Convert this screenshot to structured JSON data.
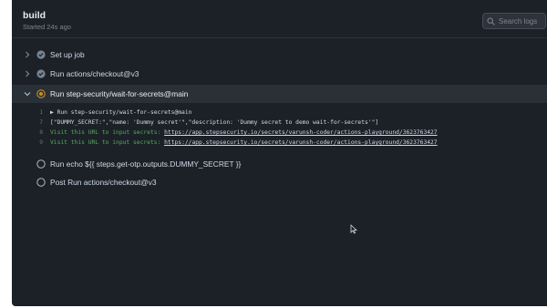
{
  "job": {
    "title": "build",
    "started": "Started 24s ago"
  },
  "search": {
    "placeholder": "Search logs",
    "icon": "search-icon"
  },
  "steps": [
    {
      "label": "Set up job",
      "status": "success",
      "expanded": false
    },
    {
      "label": "Run actions/checkout@v3",
      "status": "success",
      "expanded": false
    },
    {
      "label": "Run step-security/wait-for-secrets@main",
      "status": "in-progress",
      "expanded": true
    },
    {
      "label": "Run echo ${{ steps.get-otp.outputs.DUMMY_SECRET }}",
      "status": "pending",
      "expanded": false
    },
    {
      "label": "Post Run actions/checkout@v3",
      "status": "pending",
      "expanded": false
    }
  ],
  "log": [
    {
      "line": "1",
      "text": "▶ Run step-security/wait-for-secrets@main"
    },
    {
      "line": "7",
      "text": "[\"DUMMY_SECRET:\",\"name: 'Dummy secret'\",\"description: 'Dummy secret to demo wait-for-secrets'\"]"
    },
    {
      "line": "8",
      "prefix": "Visit this URL to input secrets: ",
      "url": "https://app.stepsecurity.io/secrets/varunsh-coder/actions-playground/3623763427"
    },
    {
      "line": "9",
      "prefix": "Visit this URL to input secrets: ",
      "url": "https://app.stepsecurity.io/secrets/varunsh-coder/actions-playground/3623763427"
    }
  ],
  "colors": {
    "panel": "#1c2128",
    "success": "#768390",
    "in_progress": "#c69026",
    "log_green": "#57ab5a"
  }
}
